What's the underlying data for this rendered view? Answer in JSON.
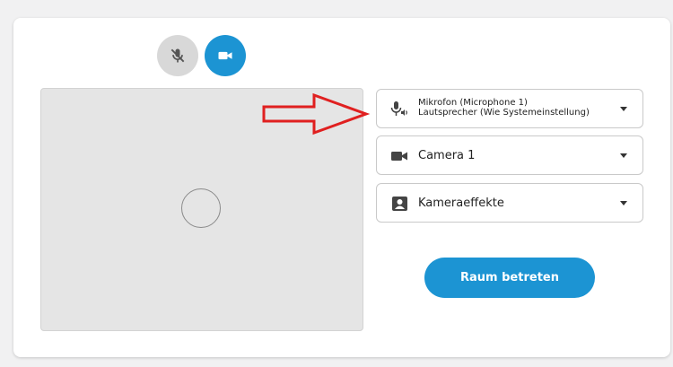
{
  "controls": {
    "mic_button": {
      "icon": "mic-off-icon",
      "state": "muted"
    },
    "camera_button": {
      "icon": "video-camera-icon",
      "state": "on"
    }
  },
  "preview": {
    "indicator": "loading-spinner-icon"
  },
  "devices": {
    "audio": {
      "icon": "microphone-speaker-icon",
      "line1": "Mikrofon (Microphone 1)",
      "line2": "Lautsprecher (Wie Systemeinstellung)"
    },
    "camera": {
      "icon": "video-camera-icon",
      "label": "Camera 1"
    },
    "effects": {
      "icon": "portrait-icon",
      "label": "Kameraeffekte"
    }
  },
  "join_button": {
    "label": "Raum betreten"
  },
  "annotation": {
    "icon": "red-arrow-icon",
    "color": "#e02020"
  },
  "colors": {
    "accent": "#1c94d3",
    "muted_button": "#d8d8d8"
  }
}
